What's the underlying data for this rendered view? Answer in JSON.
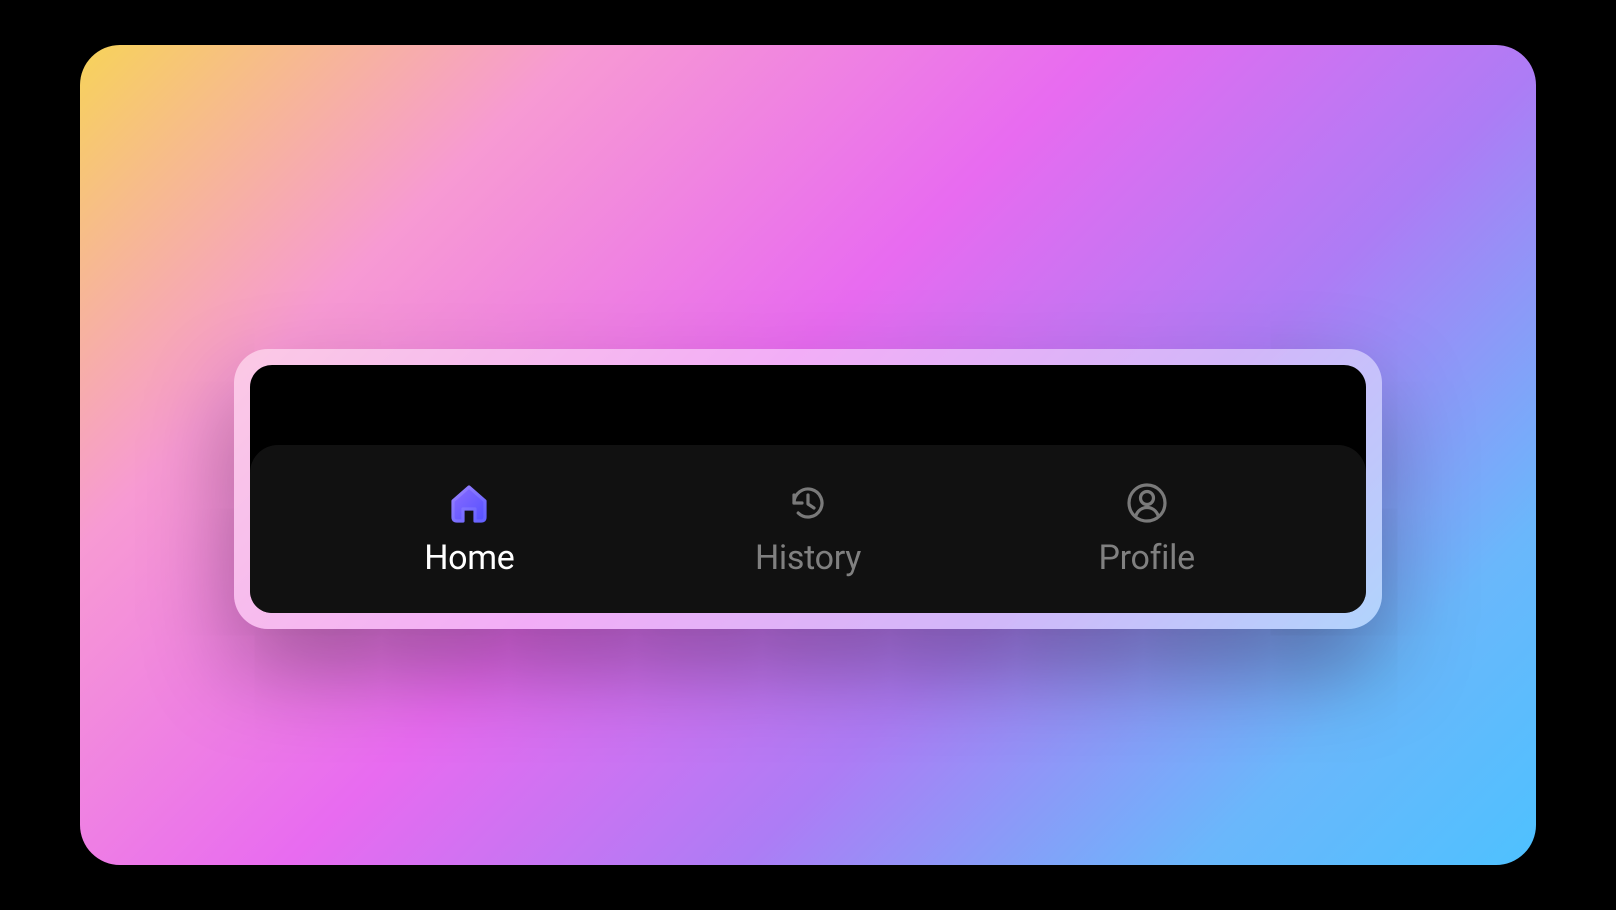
{
  "nav": {
    "items": [
      {
        "id": "home",
        "label": "Home",
        "icon": "home-icon",
        "active": true
      },
      {
        "id": "history",
        "label": "History",
        "icon": "history-icon",
        "active": false
      },
      {
        "id": "profile",
        "label": "Profile",
        "icon": "profile-icon",
        "active": false
      }
    ]
  },
  "colors": {
    "active_gradient_start": "#7A5CFF",
    "active_gradient_end": "#5E5BFF",
    "inactive_icon": "#7a7a7a",
    "active_label": "#ffffff",
    "inactive_label": "#808080"
  }
}
